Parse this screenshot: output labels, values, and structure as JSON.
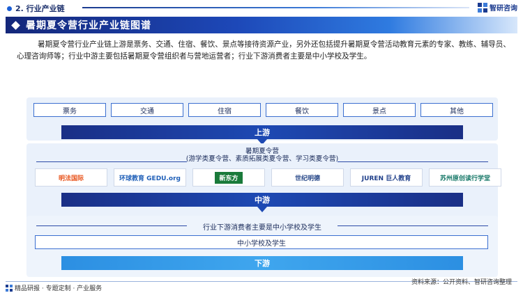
{
  "header": {
    "section_title": "2. 行业产业链",
    "brand_name": "智研咨询"
  },
  "banner": {
    "title": "暑期夏令营行业产业链图谱"
  },
  "intro_text": "暑期夏令营行业产业链上游是票务、交通、住宿、餐饮、景点等接待资源产业，另外还包括提升暑期夏令营活动教育元素的专家、教练、辅导员、心理咨询师等；行业中游主要包括暑期夏令营组织者与营地运营者；行业下游消费者主要是中小学校及学生。",
  "upstream": {
    "items": [
      "票务",
      "交通",
      "住宿",
      "餐饮",
      "景点",
      "其他"
    ],
    "bar_label": "上游"
  },
  "midstream": {
    "head_line1": "暑期夏令营",
    "head_line2": "(游学类夏令营、素质拓展类夏令营、学习类夏令营)",
    "logos": [
      {
        "text": "明法国际",
        "color": "#e8541c"
      },
      {
        "text": "环球教育 GEDU.org",
        "color": "#1f5fb8"
      },
      {
        "text": "新东方",
        "color": "#1a7a3a"
      },
      {
        "text": "世纪明德",
        "color": "#2a4a8a"
      },
      {
        "text": "JUREN 巨人教育",
        "color": "#1f3f8a"
      },
      {
        "text": "苏州原创读行学堂",
        "color": "#1a7a6a"
      }
    ],
    "bar_label": "中游"
  },
  "downstream": {
    "head": "行业下游消费者主要是中小学校及学生",
    "box": "中小学校及学生",
    "bar_label": "下游"
  },
  "footer": {
    "left": "精品研报 · 专题定制 · 产业服务",
    "right": "资料来源：公开资料、智研咨询整理"
  },
  "colors": {
    "primary": "#1d49b3",
    "dark": "#14277a",
    "light_bg": "#eaf1fb",
    "downstream": "#3fa6ee"
  }
}
